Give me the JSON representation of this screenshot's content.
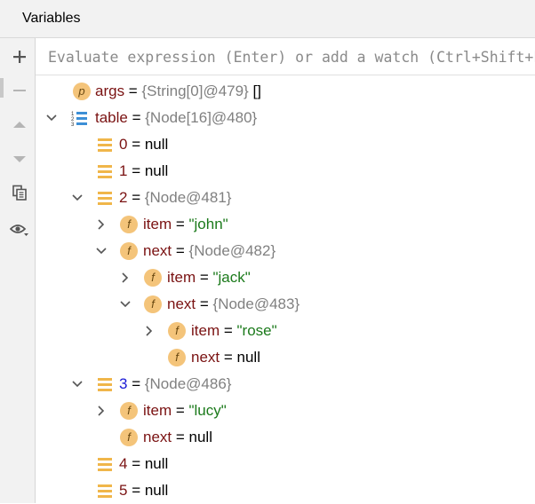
{
  "panel": {
    "title": "Variables"
  },
  "watch": {
    "placeholder": "Evaluate expression (Enter) or add a watch (Ctrl+Shift+Enter)"
  },
  "toolbar": {
    "items": [
      "add-icon",
      "remove-icon",
      "up-icon",
      "down-icon",
      "copy-icon",
      "eye-icon"
    ]
  },
  "tree": [
    {
      "name": "args",
      "eq": " = ",
      "value": "{String[0]@479}",
      "suffix": " []"
    },
    {
      "name": "table",
      "eq": " = ",
      "value": "{Node[16]@480}"
    },
    {
      "name": "0",
      "eq": " = ",
      "value": "null"
    },
    {
      "name": "1",
      "eq": " = ",
      "value": "null"
    },
    {
      "name": "2",
      "eq": " = ",
      "value": "{Node@481}"
    },
    {
      "name": "item",
      "eq": " = ",
      "value": "\"john\""
    },
    {
      "name": "next",
      "eq": " = ",
      "value": "{Node@482}"
    },
    {
      "name": "item",
      "eq": " = ",
      "value": "\"jack\""
    },
    {
      "name": "next",
      "eq": " = ",
      "value": "{Node@483}"
    },
    {
      "name": "item",
      "eq": " = ",
      "value": "\"rose\""
    },
    {
      "name": "next",
      "eq": " = ",
      "value": "null"
    },
    {
      "name": "3",
      "eq": " = ",
      "value": "{Node@486}"
    },
    {
      "name": "item",
      "eq": " = ",
      "value": "\"lucy\""
    },
    {
      "name": "next",
      "eq": " = ",
      "value": "null"
    },
    {
      "name": "4",
      "eq": " = ",
      "value": "null"
    },
    {
      "name": "5",
      "eq": " = ",
      "value": "null"
    }
  ],
  "badges": {
    "param": "p",
    "field": "f"
  },
  "colors": {
    "name": "#7a1212",
    "index_highlight": "#1a1ad6",
    "object_value": "#808080",
    "string_value": "#1b7a1b",
    "badge": "#f4c47a",
    "array_icon": "#f0b64a"
  }
}
